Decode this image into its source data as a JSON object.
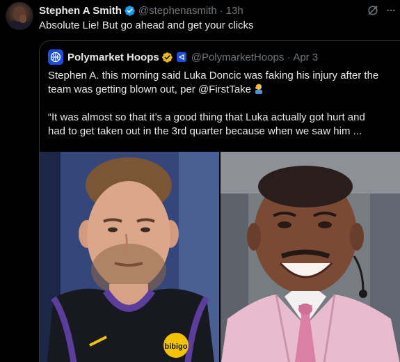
{
  "tweet": {
    "author_name": "Stephen A Smith",
    "handle": "@stephenasmith",
    "separator": "·",
    "time": "13h",
    "text": "Absolute Lie! But go ahead and get your clicks"
  },
  "quoted_tweet": {
    "author_name": "Polymarket Hoops",
    "handle": "@PolymarketHoops",
    "separator": "·",
    "time": "Apr 3",
    "line1": "Stephen A. this morning said Luka Doncic was faking his injury after the",
    "line2": "team was getting blown out, per @FirstTake",
    "line3": "“It was almost so that it’s a good thing that Luka actually got hurt and",
    "line4": "had to get taken out in the 3rd quarter because when we saw him ...",
    "jersey_sponsor": "bibigo"
  },
  "colors": {
    "background": "#000000",
    "text": "#e7e9ea",
    "secondary_text": "#71767b",
    "verified_blue": "#1d9bf0",
    "verified_gold": "#e8b829",
    "border": "#2f3336"
  },
  "icons": {
    "verified": "blue-check-badge",
    "org_verified": "gold-check-badge",
    "affiliate": "affiliate-badge",
    "grok": "grok-icon",
    "more": "more-dots-icon",
    "emoji": "man-facepalming"
  }
}
